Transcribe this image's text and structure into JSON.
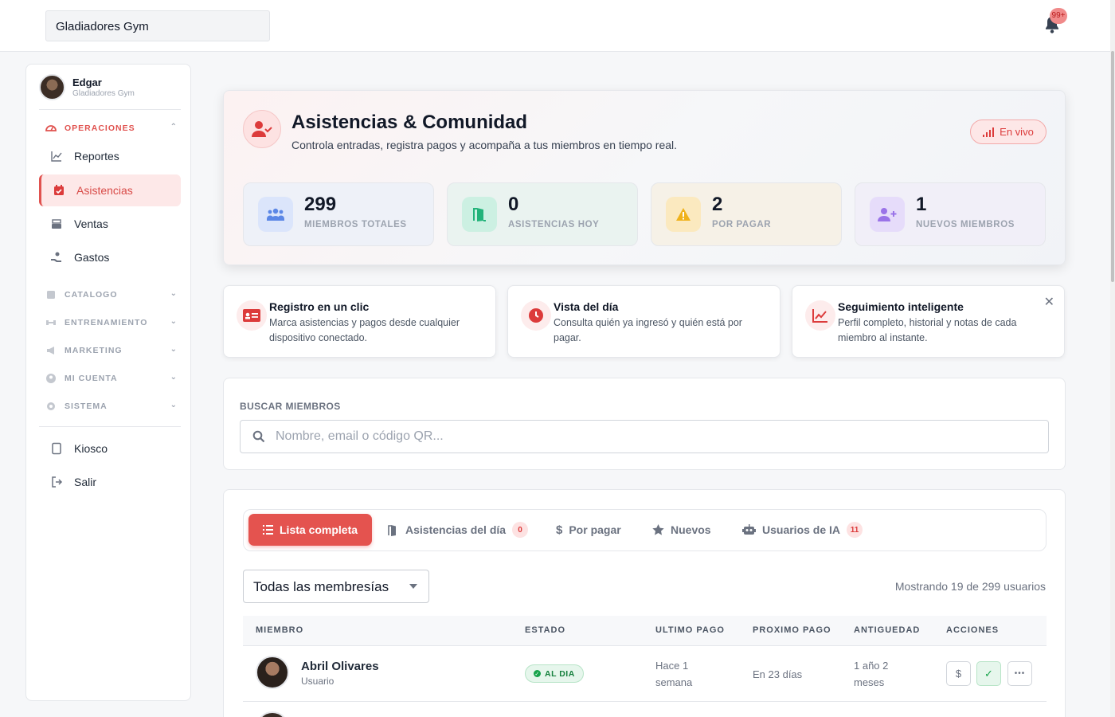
{
  "header": {
    "gym_selector": "Gladiadores Gym",
    "notifications_badge": "99+"
  },
  "sidebar": {
    "user_name": "Edgar",
    "user_gym": "Gladiadores Gym",
    "sections": {
      "operaciones": "OPERACIONES",
      "catalogo": "CATALOGO",
      "entrenamiento": "ENTRENAMIENTO",
      "marketing": "MARKETING",
      "mi_cuenta": "MI CUENTA",
      "sistema": "SISTEMA"
    },
    "items": {
      "reportes": "Reportes",
      "asistencias": "Asistencias",
      "ventas": "Ventas",
      "gastos": "Gastos",
      "kiosco": "Kiosco",
      "salir": "Salir"
    }
  },
  "hero": {
    "title": "Asistencias & Comunidad",
    "subtitle": "Controla entradas, registra pagos y acompaña a tus miembros en tiempo real.",
    "live_label": "En vivo",
    "stats": [
      {
        "value": "299",
        "label": "MIEMBROS TOTALES"
      },
      {
        "value": "0",
        "label": "ASISTENCIAS HOY"
      },
      {
        "value": "2",
        "label": "POR PAGAR"
      },
      {
        "value": "1",
        "label": "NUEVOS MIEMBROS"
      }
    ]
  },
  "features": [
    {
      "title": "Registro en un clic",
      "desc": "Marca asistencias y pagos desde cualquier dispositivo conectado."
    },
    {
      "title": "Vista del día",
      "desc": "Consulta quién ya ingresó y quién está por pagar."
    },
    {
      "title": "Seguimiento inteligente",
      "desc": "Perfil completo, historial y notas de cada miembro al instante."
    }
  ],
  "search": {
    "label": "BUSCAR MIEMBROS",
    "placeholder": "Nombre, email o código QR..."
  },
  "tabs": {
    "lista": "Lista completa",
    "asistencias": "Asistencias del día",
    "asistencias_count": "0",
    "por_pagar": "Por pagar",
    "nuevos": "Nuevos",
    "ia": "Usuarios de IA",
    "ia_count": "11"
  },
  "filter": {
    "membership": "Todas las membresías",
    "showing": "Mostrando 19 de 299 usuarios"
  },
  "table": {
    "headers": [
      "MIEMBRO",
      "ESTADO",
      "ULTIMO PAGO",
      "PROXIMO PAGO",
      "ANTIGUEDAD",
      "ACCIONES"
    ],
    "rows": [
      {
        "name": "Abril Olivares",
        "role": "Usuario",
        "status": "AL DIA",
        "last_payment": "Hace 1 semana",
        "next_payment": "En 23 días",
        "seniority": "1 año 2 meses"
      }
    ]
  },
  "colors": {
    "accent": "#e4534f",
    "accent_soft": "#fde8e8",
    "success": "#16a34a"
  }
}
